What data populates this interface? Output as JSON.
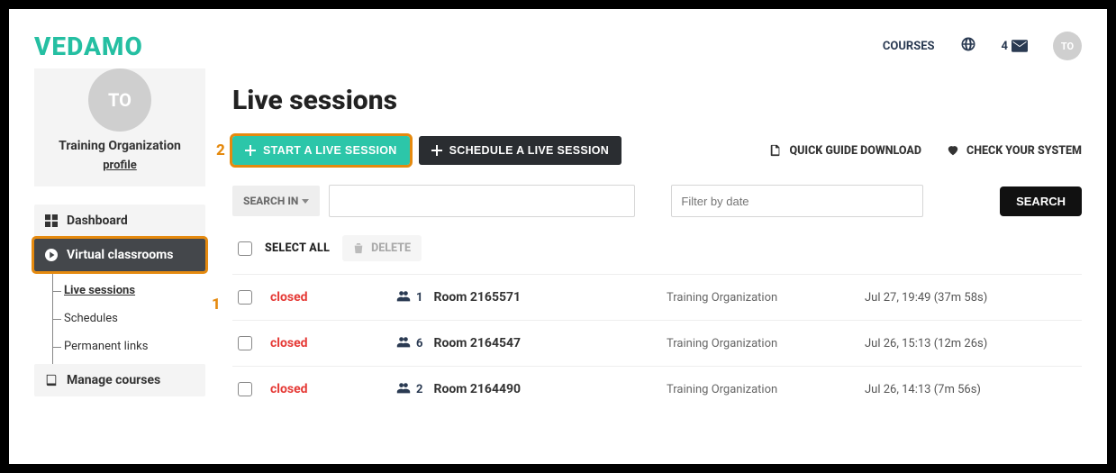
{
  "header": {
    "logo": "VEDAMO",
    "courses": "COURSES",
    "mail_count": "4",
    "avatar": "TO"
  },
  "profile": {
    "avatar": "TO",
    "org": "Training Organization",
    "profile_link": "profile"
  },
  "nav": {
    "dashboard": "Dashboard",
    "virtual": "Virtual classrooms",
    "sub": {
      "live": "Live sessions",
      "sched": "Schedules",
      "perm": "Permanent links"
    },
    "manage": "Manage courses"
  },
  "page": {
    "title": "Live sessions",
    "start": "START A LIVE SESSION",
    "schedule": "SCHEDULE A LIVE SESSION",
    "quick": "QUICK GUIDE DOWNLOAD",
    "check": "CHECK YOUR SYSTEM",
    "search_in": "SEARCH IN",
    "date_ph": "Filter by date",
    "search_btn": "SEARCH",
    "select_all": "SELECT ALL",
    "delete": "DELETE"
  },
  "annotations": {
    "one": "1",
    "two": "2"
  },
  "rows": [
    {
      "status": "closed",
      "count": "1",
      "room": "Room 2165571",
      "org": "Training Organization",
      "time": "Jul 27, 19:49 (37m 58s)"
    },
    {
      "status": "closed",
      "count": "6",
      "room": "Room 2164547",
      "org": "Training Organization",
      "time": "Jul 26, 15:13 (12m 26s)"
    },
    {
      "status": "closed",
      "count": "2",
      "room": "Room 2164490",
      "org": "Training Organization",
      "time": "Jul 26, 14:13 (7m 56s)"
    }
  ]
}
